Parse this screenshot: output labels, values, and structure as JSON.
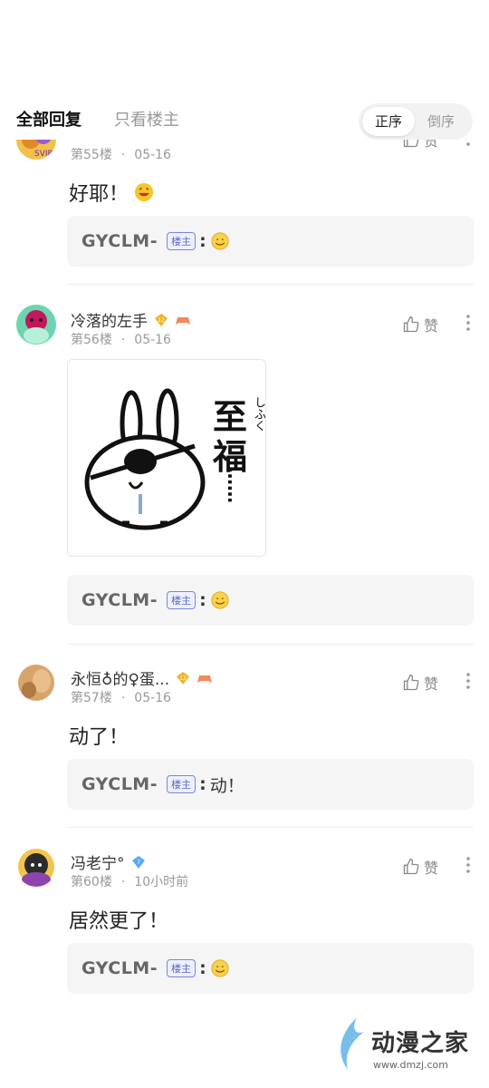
{
  "tabs": {
    "all_replies": "全部回复",
    "op_only": "只看楼主"
  },
  "sort": {
    "asc": "正序",
    "desc": "倒序"
  },
  "like_label": "赞",
  "op_badge": "楼主",
  "posts": [
    {
      "name": "",
      "floor": "第55楼",
      "date": "05-16",
      "text": "好耶！",
      "reply_user": "GYCLM-",
      "reply_text": ""
    },
    {
      "name": "冷落的左手",
      "floor": "第56楼",
      "date": "05-16",
      "text": "",
      "reply_user": "GYCLM-",
      "reply_text": "",
      "sticker": {
        "big1": "至",
        "big2": "福",
        "small": "しふく",
        "dots": "……"
      }
    },
    {
      "name": "永恒♁的♀蛋...",
      "floor": "第57楼",
      "date": "05-16",
      "text": "动了！",
      "reply_user": "GYCLM-",
      "reply_text": "动！"
    },
    {
      "name": "冯老宁°",
      "floor": "第60楼",
      "date": "10小时前",
      "text": "居然更了！",
      "reply_user": "GYCLM-",
      "reply_text": ""
    }
  ],
  "watermark": {
    "name": "动漫之家",
    "url": "www.dmzj.com"
  },
  "colors": {
    "accent": "#5b67c8",
    "badge_gold": "#f0b429",
    "reply_bg": "#f5f5f5"
  }
}
